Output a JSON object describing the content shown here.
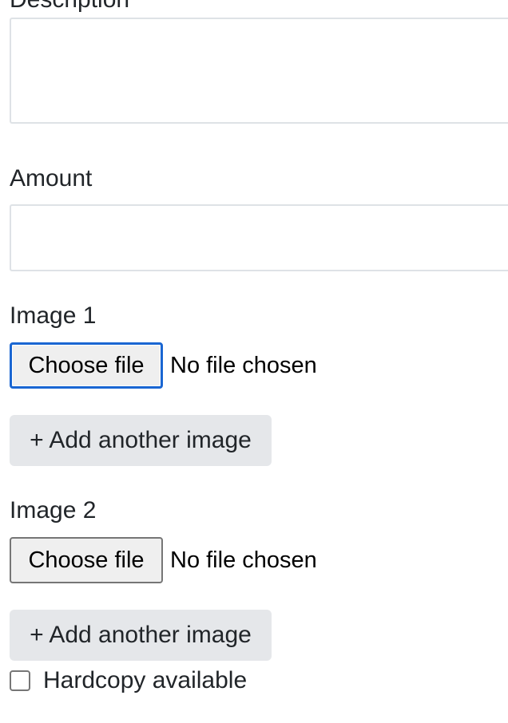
{
  "form": {
    "description": {
      "label": "Description",
      "value": ""
    },
    "amount": {
      "label": "Amount",
      "value": ""
    },
    "images": [
      {
        "label": "Image 1",
        "choose_label": "Choose file",
        "status": "No file chosen",
        "add_label": "+ Add another image"
      },
      {
        "label": "Image 2",
        "choose_label": "Choose file",
        "status": "No file chosen",
        "add_label": "+ Add another image"
      }
    ],
    "hardcopy": {
      "label": "Hardcopy available",
      "checked": false
    }
  }
}
